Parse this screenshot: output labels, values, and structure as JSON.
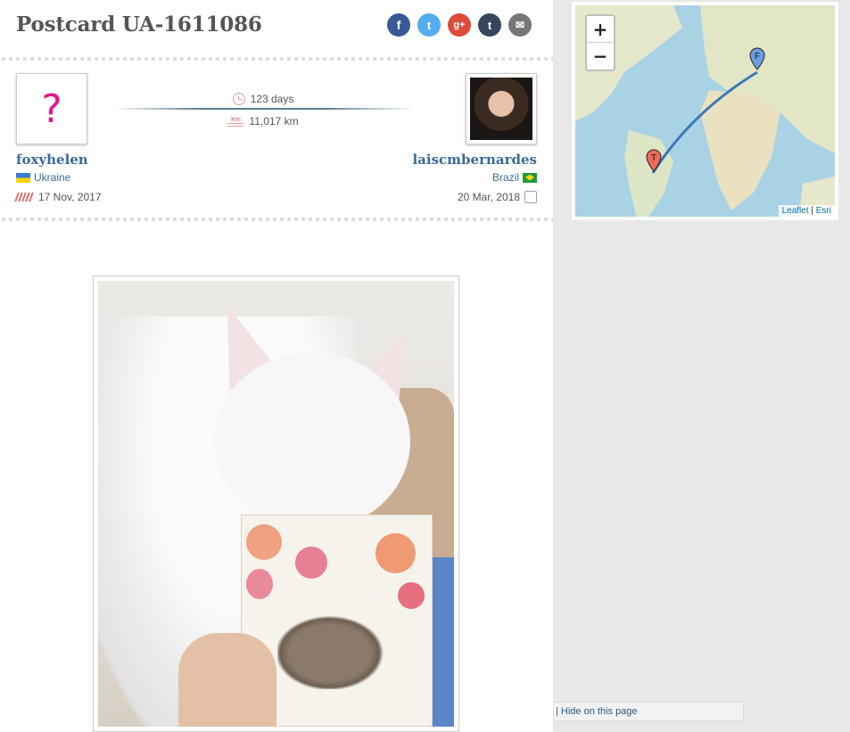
{
  "page": {
    "title": "Postcard UA-1611086"
  },
  "share": {
    "facebook": "f",
    "twitter": "t",
    "googleplus": "g+",
    "tumblr": "t",
    "email": "✉"
  },
  "sender": {
    "username": "foxyhelen",
    "country": "Ukraine",
    "sent_date": "17 Nov, 2017",
    "avatar_placeholder": "?"
  },
  "receiver": {
    "username": "laiscmbernardes",
    "country": "Brazil",
    "received_date": "20 Mar, 2018"
  },
  "travel": {
    "days": "123 days",
    "distance": "11,017 km",
    "km_label": "Km"
  },
  "map": {
    "zoom_in": "+",
    "zoom_out": "−",
    "from_marker": "F",
    "to_marker": "T",
    "attribution_leaflet": "Leaflet",
    "attribution_sep": " | ",
    "attribution_esri": "Esri",
    "route_color": "#3a78b8"
  },
  "footer": {
    "separator": "|",
    "hide_label": "Hide on this page"
  },
  "colors": {
    "facebook": "#3b5998",
    "twitter": "#55acee",
    "googleplus": "#dd4b39",
    "tumblr": "#35465c",
    "email": "#777777",
    "link": "#3a6a9b"
  }
}
